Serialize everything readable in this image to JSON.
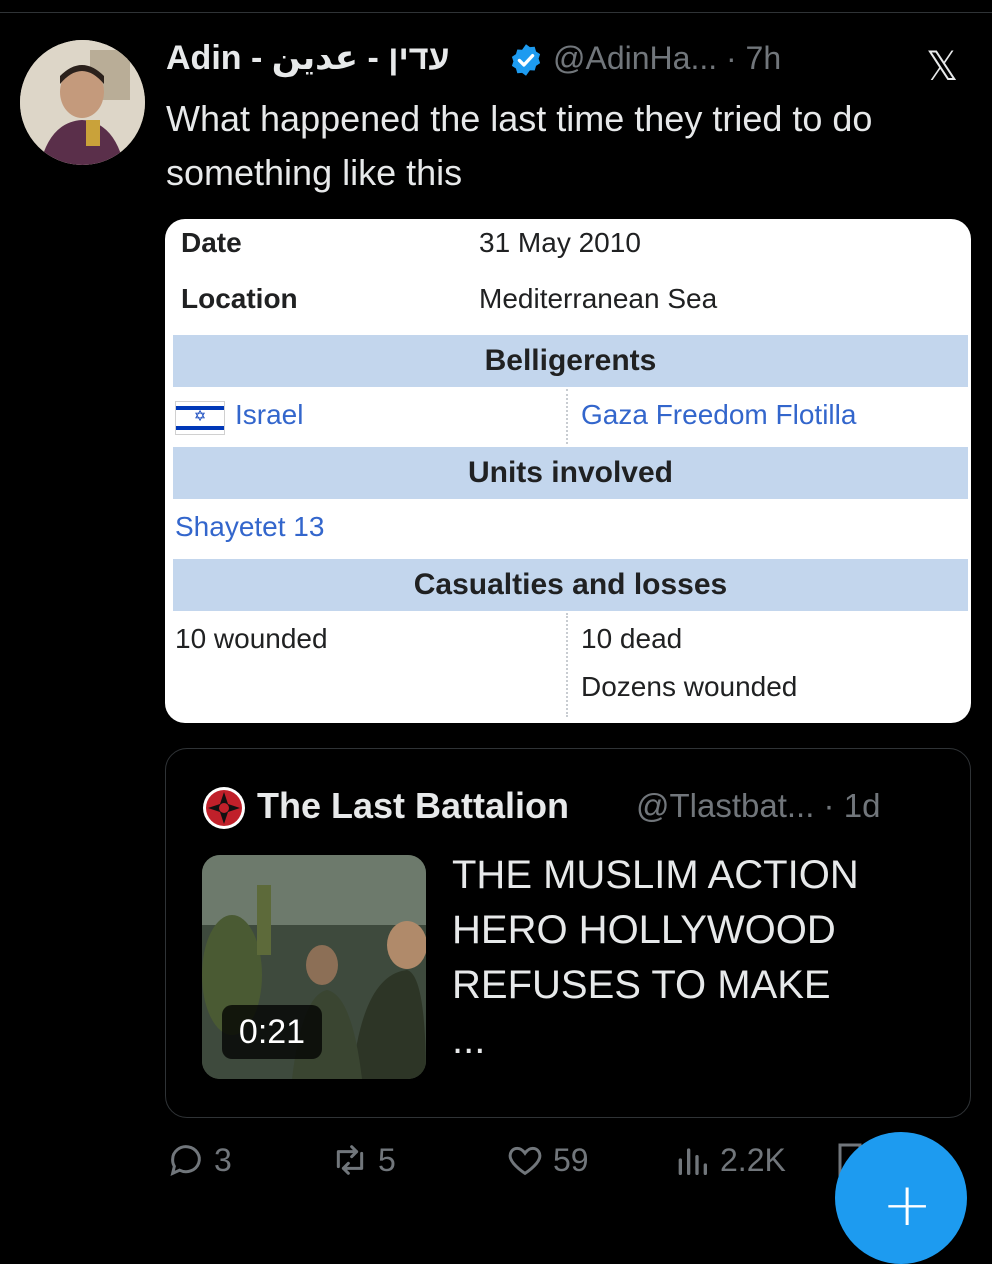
{
  "tweet": {
    "author_name": "Adin - עדין - عدين",
    "handle_time": "@AdinHa... · 7h",
    "text": "What happened the last time they tried to do something like this"
  },
  "infobox": {
    "date_label": "Date",
    "date_value": "31 May 2010",
    "location_label": "Location",
    "location_value": "Mediterranean Sea",
    "belligerents_header": "Belligerents",
    "belligerent_1": "Israel",
    "belligerent_2": "Gaza Freedom Flotilla",
    "units_header": "Units involved",
    "unit_1": "Shayetet 13",
    "casualties_header": "Casualties and losses",
    "casualties_1": "10 wounded",
    "casualties_2a": "10 dead",
    "casualties_2b": "Dozens wounded"
  },
  "quote": {
    "name": "The Last Battalion",
    "handle_time": "@Tlastbat... · 1d",
    "duration": "0:21",
    "text_lines": [
      "THE MUSLIM ACTION",
      "HERO HOLLYWOOD",
      "REFUSES TO MAKE",
      "..."
    ]
  },
  "actions": {
    "replies": "3",
    "reposts": "5",
    "likes": "59",
    "views": "2.2K"
  },
  "colors": {
    "accent": "#1d9bf0",
    "link": "#3366cc",
    "header_band": "#c3d6ed",
    "muted": "#71767b"
  },
  "icons": [
    "verified-badge-icon",
    "x-logo-icon",
    "reply-icon",
    "repost-icon",
    "like-icon",
    "views-icon",
    "bookmark-icon",
    "plus-icon"
  ]
}
